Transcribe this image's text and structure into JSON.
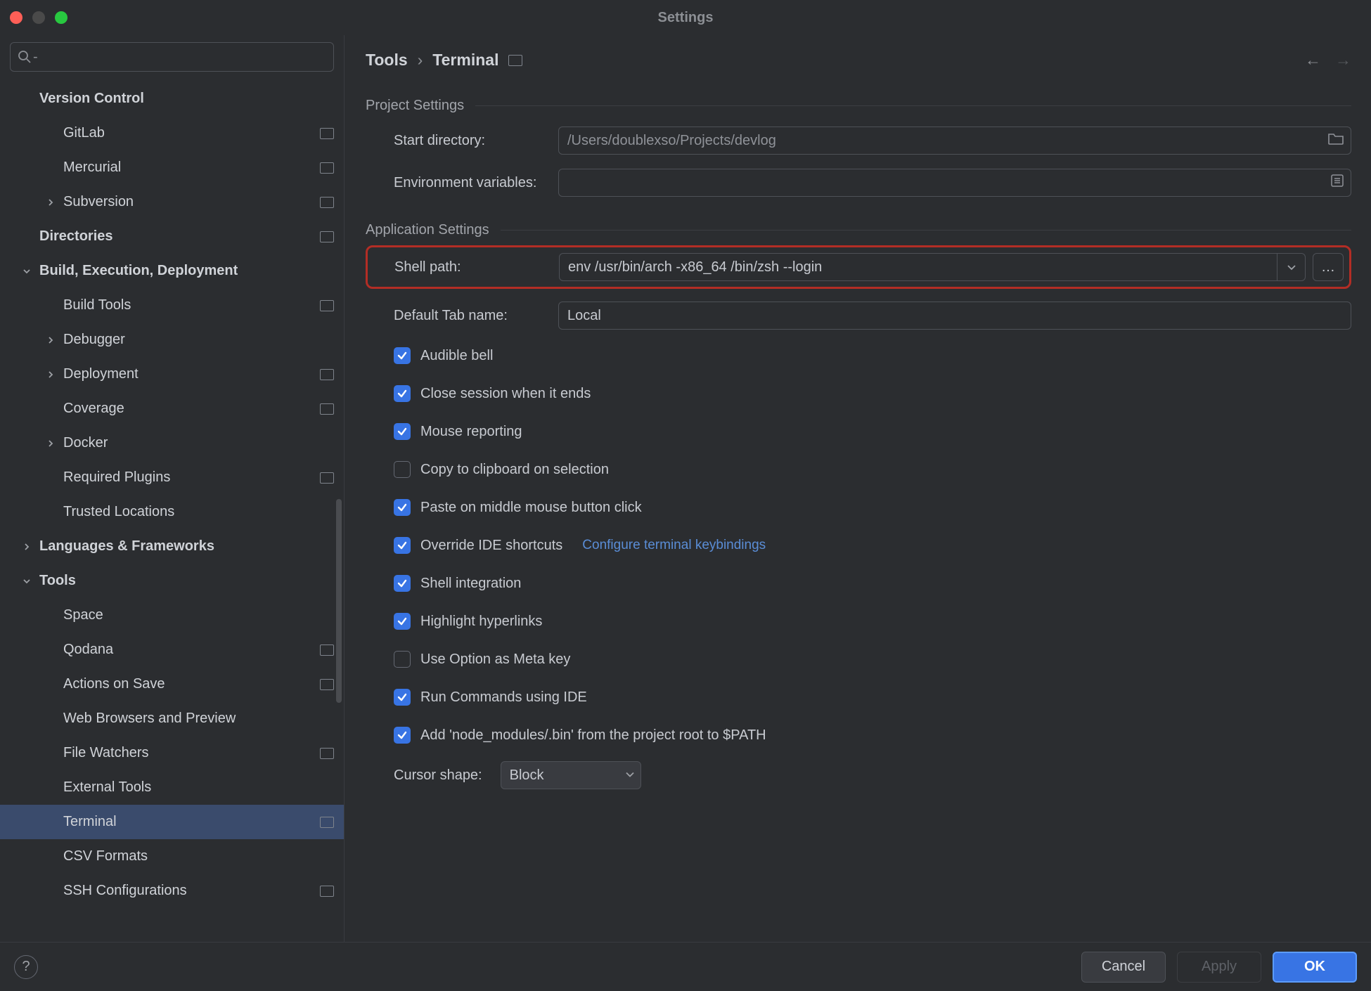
{
  "window": {
    "title": "Settings"
  },
  "search": {
    "placeholder": ""
  },
  "sidebar": {
    "items": [
      {
        "label": "Version Control",
        "bold": true,
        "indent": 56,
        "chevron": "",
        "proj": false
      },
      {
        "label": "GitLab",
        "bold": false,
        "indent": 90,
        "chevron": "",
        "proj": true
      },
      {
        "label": "Mercurial",
        "bold": false,
        "indent": 90,
        "chevron": "",
        "proj": true
      },
      {
        "label": "Subversion",
        "bold": false,
        "indent": 62,
        "chevron": "right",
        "proj": true
      },
      {
        "label": "Directories",
        "bold": true,
        "indent": 56,
        "chevron": "",
        "proj": true
      },
      {
        "label": "Build, Execution, Deployment",
        "bold": true,
        "indent": 28,
        "chevron": "down",
        "proj": false
      },
      {
        "label": "Build Tools",
        "bold": false,
        "indent": 90,
        "chevron": "",
        "proj": true
      },
      {
        "label": "Debugger",
        "bold": false,
        "indent": 62,
        "chevron": "right",
        "proj": false
      },
      {
        "label": "Deployment",
        "bold": false,
        "indent": 62,
        "chevron": "right",
        "proj": true
      },
      {
        "label": "Coverage",
        "bold": false,
        "indent": 90,
        "chevron": "",
        "proj": true
      },
      {
        "label": "Docker",
        "bold": false,
        "indent": 62,
        "chevron": "right",
        "proj": false
      },
      {
        "label": "Required Plugins",
        "bold": false,
        "indent": 90,
        "chevron": "",
        "proj": true
      },
      {
        "label": "Trusted Locations",
        "bold": false,
        "indent": 90,
        "chevron": "",
        "proj": false
      },
      {
        "label": "Languages & Frameworks",
        "bold": true,
        "indent": 28,
        "chevron": "right",
        "proj": false
      },
      {
        "label": "Tools",
        "bold": true,
        "indent": 28,
        "chevron": "down",
        "proj": false
      },
      {
        "label": "Space",
        "bold": false,
        "indent": 90,
        "chevron": "",
        "proj": false
      },
      {
        "label": "Qodana",
        "bold": false,
        "indent": 90,
        "chevron": "",
        "proj": true
      },
      {
        "label": "Actions on Save",
        "bold": false,
        "indent": 90,
        "chevron": "",
        "proj": true
      },
      {
        "label": "Web Browsers and Preview",
        "bold": false,
        "indent": 90,
        "chevron": "",
        "proj": false
      },
      {
        "label": "File Watchers",
        "bold": false,
        "indent": 90,
        "chevron": "",
        "proj": true
      },
      {
        "label": "External Tools",
        "bold": false,
        "indent": 90,
        "chevron": "",
        "proj": false
      },
      {
        "label": "Terminal",
        "bold": false,
        "indent": 90,
        "chevron": "",
        "proj": true,
        "selected": true
      },
      {
        "label": "CSV Formats",
        "bold": false,
        "indent": 90,
        "chevron": "",
        "proj": false
      },
      {
        "label": "SSH Configurations",
        "bold": false,
        "indent": 90,
        "chevron": "",
        "proj": true
      }
    ]
  },
  "breadcrumb": {
    "parent": "Tools",
    "current": "Terminal"
  },
  "project_section": {
    "title": "Project Settings",
    "start_directory_label": "Start directory:",
    "start_directory_value": "/Users/doublexso/Projects/devlog",
    "env_label": "Environment variables:",
    "env_value": ""
  },
  "app_section": {
    "title": "Application Settings",
    "shell_path_label": "Shell path:",
    "shell_path_value": "env /usr/bin/arch -x86_64 /bin/zsh --login",
    "default_tab_label": "Default Tab name:",
    "default_tab_value": "Local",
    "checkboxes": [
      {
        "label": "Audible bell",
        "checked": true
      },
      {
        "label": "Close session when it ends",
        "checked": true
      },
      {
        "label": "Mouse reporting",
        "checked": true
      },
      {
        "label": "Copy to clipboard on selection",
        "checked": false
      },
      {
        "label": "Paste on middle mouse button click",
        "checked": true
      },
      {
        "label": "Override IDE shortcuts",
        "checked": true,
        "link": "Configure terminal keybindings"
      },
      {
        "label": "Shell integration",
        "checked": true
      },
      {
        "label": "Highlight hyperlinks",
        "checked": true
      },
      {
        "label": "Use Option as Meta key",
        "checked": false
      },
      {
        "label": "Run Commands using IDE",
        "checked": true
      },
      {
        "label": "Add 'node_modules/.bin' from the project root to $PATH",
        "checked": true
      }
    ],
    "cursor_label": "Cursor shape:",
    "cursor_value": "Block"
  },
  "footer": {
    "cancel": "Cancel",
    "apply": "Apply",
    "ok": "OK"
  }
}
